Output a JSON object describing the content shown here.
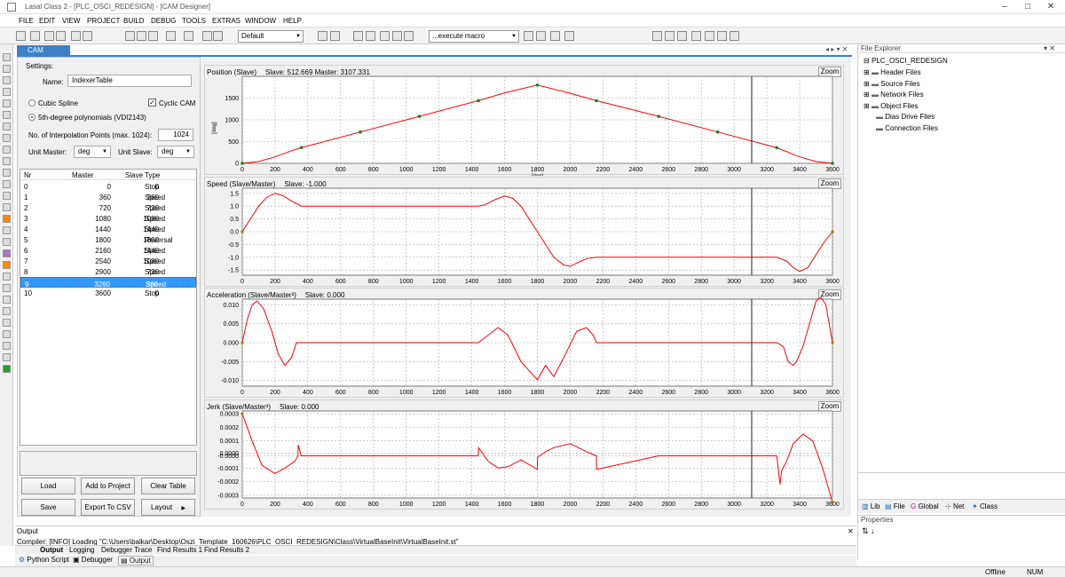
{
  "window": {
    "title": "Lasal Class 2 - [PLC_OSCI_REDESIGN] - [CAM Designer]"
  },
  "menu": [
    "FILE",
    "EDIT",
    "VIEW",
    "PROJECT",
    "BUILD",
    "DEBUG",
    "TOOLS",
    "EXTRAS",
    "WINDOW",
    "HELP"
  ],
  "toolbar": {
    "config": "Default",
    "macro": "...execute macro"
  },
  "doc_tab": "CAM Designer",
  "settings": {
    "heading": "Settings:",
    "name_label": "Name:",
    "name_value": "IndexerTable",
    "cubic": "Cubic Spline",
    "cyclic": "Cyclic CAM",
    "poly": "5th-degree polynomials (VDI2143)",
    "interp_label": "No. of Interpolation Points (max. 1024):",
    "interp_value": "1024",
    "unit_master_label": "Unit Master:",
    "unit_master": "deg",
    "unit_slave_label": "Unit Slave:",
    "unit_slave": "deg"
  },
  "table": {
    "headers": [
      "Nr",
      "Master",
      "Slave",
      "Type"
    ],
    "rows": [
      [
        "0",
        "0",
        "0",
        "Stop"
      ],
      [
        "1",
        "360",
        "360",
        "Speed"
      ],
      [
        "2",
        "720",
        "720",
        "Speed"
      ],
      [
        "3",
        "1080",
        "1080",
        "Speed"
      ],
      [
        "4",
        "1440",
        "1440",
        "Speed"
      ],
      [
        "5",
        "1800",
        "1800",
        "Reversal"
      ],
      [
        "6",
        "2160",
        "1440",
        "Speed"
      ],
      [
        "7",
        "2540",
        "1080",
        "Speed"
      ],
      [
        "8",
        "2900",
        "720",
        "Speed"
      ],
      [
        "9",
        "3260",
        "360",
        "Speed"
      ],
      [
        "10",
        "3600",
        "0",
        "Stop"
      ]
    ],
    "selected_row": 9
  },
  "buttons": {
    "load": "Load",
    "add": "Add to Project",
    "clear": "Clear Table",
    "save": "Save",
    "export": "Export To CSV",
    "layout": "Layout"
  },
  "charts": [
    {
      "title": "Position (Slave)",
      "values": "Slave: 512.669   Master: 3107.331",
      "zoom": "Zoom",
      "ylabel": "[deg]",
      "xunit": "[deg]",
      "yticks": [
        "0",
        "500",
        "1000",
        "1500"
      ],
      "yrange": [
        0,
        2000
      ]
    },
    {
      "title": "Speed (Slave/Master)",
      "values": "Slave: -1.000",
      "zoom": "Zoom",
      "yticks": [
        "-1.5",
        "-1.0",
        "-0.5",
        "0.0",
        "0.5",
        "1.0",
        "1.5"
      ],
      "yrange": [
        -1.7,
        1.7
      ]
    },
    {
      "title": "Acceleration (Slave/Master²)",
      "values": "Slave: 0.000",
      "zoom": "Zoom",
      "yticks": [
        "-0.010",
        "-0.005",
        "0.000",
        "0.005",
        "0.010"
      ],
      "yrange": [
        -0.0115,
        0.0115
      ]
    },
    {
      "title": "Jerk (Slave/Master³)",
      "values": "Slave: 0.000",
      "zoom": "Zoom",
      "yticks": [
        "-0.0003",
        "-0.0002",
        "-0.0001",
        "-0.0000",
        "0.0000",
        "0.0001",
        "0.0002",
        "0.0003"
      ],
      "yrange": [
        -0.00032,
        0.00032
      ]
    }
  ],
  "chart_data": {
    "type": "line",
    "x_ticks": [
      "0",
      "200",
      "400",
      "600",
      "800",
      "1000",
      "1200",
      "1400",
      "1600",
      "1800",
      "2000",
      "2200",
      "2400",
      "2600",
      "2800",
      "3000",
      "3200",
      "3400",
      "3600"
    ],
    "cursor_x": 3107.331,
    "position": {
      "x": [
        0,
        100,
        200,
        300,
        360,
        720,
        1080,
        1440,
        1600,
        1800,
        2000,
        2160,
        2540,
        2900,
        3260,
        3400,
        3500,
        3600
      ],
      "y": [
        0,
        40,
        150,
        290,
        360,
        720,
        1080,
        1440,
        1620,
        1800,
        1610,
        1440,
        1080,
        720,
        360,
        150,
        40,
        0
      ],
      "markers_x": [
        0,
        360,
        720,
        1080,
        1440,
        1800,
        2160,
        2540,
        2900,
        3260,
        3600
      ],
      "markers_y": [
        0,
        360,
        720,
        1080,
        1440,
        1800,
        1440,
        1080,
        720,
        360,
        0
      ]
    },
    "speed": {
      "x": [
        0,
        40,
        100,
        150,
        200,
        250,
        300,
        360,
        1440,
        1480,
        1540,
        1600,
        1650,
        1700,
        1800,
        1900,
        1960,
        2000,
        2050,
        2100,
        2160,
        2540,
        2900,
        3100,
        3260,
        3320,
        3360,
        3400,
        3450,
        3500,
        3550,
        3600
      ],
      "y": [
        0,
        0.4,
        1.0,
        1.35,
        1.5,
        1.4,
        1.2,
        1.0,
        1.0,
        1.05,
        1.25,
        1.4,
        1.3,
        1.0,
        0.0,
        -1.0,
        -1.3,
        -1.35,
        -1.2,
        -1.05,
        -1.0,
        -1.0,
        -1.0,
        -1.0,
        -1.0,
        -1.15,
        -1.4,
        -1.55,
        -1.4,
        -0.9,
        -0.4,
        0
      ]
    },
    "acceleration": {
      "x": [
        0,
        30,
        60,
        90,
        130,
        180,
        220,
        260,
        300,
        330,
        360,
        1440,
        1500,
        1560,
        1620,
        1700,
        1800,
        1850,
        1900,
        1960,
        2040,
        2100,
        2140,
        2160,
        3260,
        3300,
        3330,
        3360,
        3380,
        3420,
        3460,
        3500,
        3530,
        3560,
        3600
      ],
      "y": [
        0,
        0.006,
        0.01,
        0.011,
        0.009,
        0.003,
        -0.003,
        -0.006,
        -0.004,
        0,
        0,
        0,
        0.002,
        0.004,
        0.002,
        -0.005,
        -0.0098,
        -0.006,
        -0.009,
        -0.004,
        0.003,
        0.004,
        0.002,
        0,
        0,
        -0.001,
        -0.005,
        -0.006,
        -0.005,
        -0.001,
        0.005,
        0.011,
        0.012,
        0.01,
        0
      ]
    },
    "jerk": {
      "x": [
        0,
        60,
        120,
        200,
        260,
        320,
        340,
        341,
        360,
        1440,
        1441,
        1500,
        1560,
        1620,
        1700,
        1800,
        1801,
        1850,
        1900,
        2000,
        2100,
        2160,
        2161,
        2540,
        2600,
        2900,
        3260,
        3280,
        3290,
        3320,
        3360,
        3420,
        3480,
        3540,
        3600
      ],
      "y": [
        0.0003,
        0.0001,
        -8e-05,
        -0.00014,
        -0.0001,
        -5e-05,
        -1e-05,
        7e-05,
        -1e-05,
        -1e-05,
        5e-05,
        -5e-05,
        -0.0001,
        -9e-05,
        -4e-05,
        -0.00011,
        -2e-05,
        2e-05,
        5e-05,
        8e-05,
        2e-05,
        -1e-05,
        -0.00011,
        -1e-05,
        -1e-05,
        -1e-05,
        -1e-05,
        -0.00022,
        -0.00012,
        -5e-05,
        8e-05,
        0.00015,
        0.0001,
        -0.0001,
        -0.00035
      ]
    }
  },
  "right": {
    "file_explorer": "File Explorer",
    "root": "PLC_OSCI_REDESIGN",
    "items": [
      "Header Files",
      "Source Files",
      "Network Files",
      "Object Files",
      "Dias Drive Files",
      "Connection Files"
    ],
    "tabs": [
      "Lib",
      "File",
      "Global",
      "Net",
      "Class"
    ],
    "properties": "Properties"
  },
  "output": {
    "heading": "Output",
    "text": "Compiler: [INFO] Loading \"C:\\Users\\balkar\\Desktop\\Oszi_Template_160626\\PLC_OSCI_REDESIGN\\Class\\VirtualBaseInit\\VirtualBaseInit.st\"",
    "tabs": [
      "Output",
      "Logging",
      "Debugger Trace",
      "Find Results 1",
      "Find Results 2"
    ],
    "bottom_tabs": [
      "Python Script",
      "Debugger",
      "Output"
    ]
  },
  "status": {
    "offline": "Offline",
    "num": "NUM"
  },
  "colors": {
    "accent": "#3d80c8",
    "curve": "#ff0000",
    "marker": "#2a7a2a"
  }
}
